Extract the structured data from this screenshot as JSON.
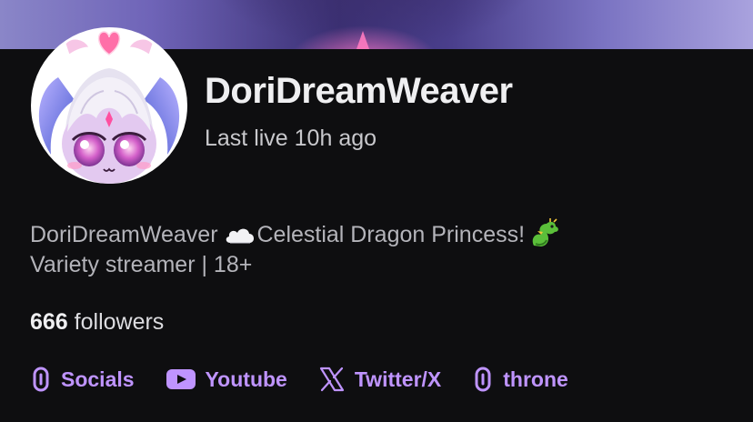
{
  "channel": {
    "name": "DoriDreamWeaver",
    "last_live": "Last live 10h ago"
  },
  "bio": {
    "line1_a": "DoriDreamWeaver ",
    "line1_cloud_icon": "cloud-emoji",
    "line1_b": "Celestial Dragon Princess!",
    "line1_dragon_icon": "dragon-emoji",
    "line2": "Variety streamer | 18+"
  },
  "followers": {
    "count": "666",
    "label": " followers"
  },
  "links": [
    {
      "label": "Socials",
      "icon": "link-icon"
    },
    {
      "label": "Youtube",
      "icon": "youtube-icon"
    },
    {
      "label": "Twitter/X",
      "icon": "x-icon"
    },
    {
      "label": "throne",
      "icon": "link-icon"
    }
  ],
  "colors": {
    "background": "#0e0e10",
    "accent": "#bf94ff",
    "title": "#efeff1",
    "muted": "#b4b4ba"
  }
}
